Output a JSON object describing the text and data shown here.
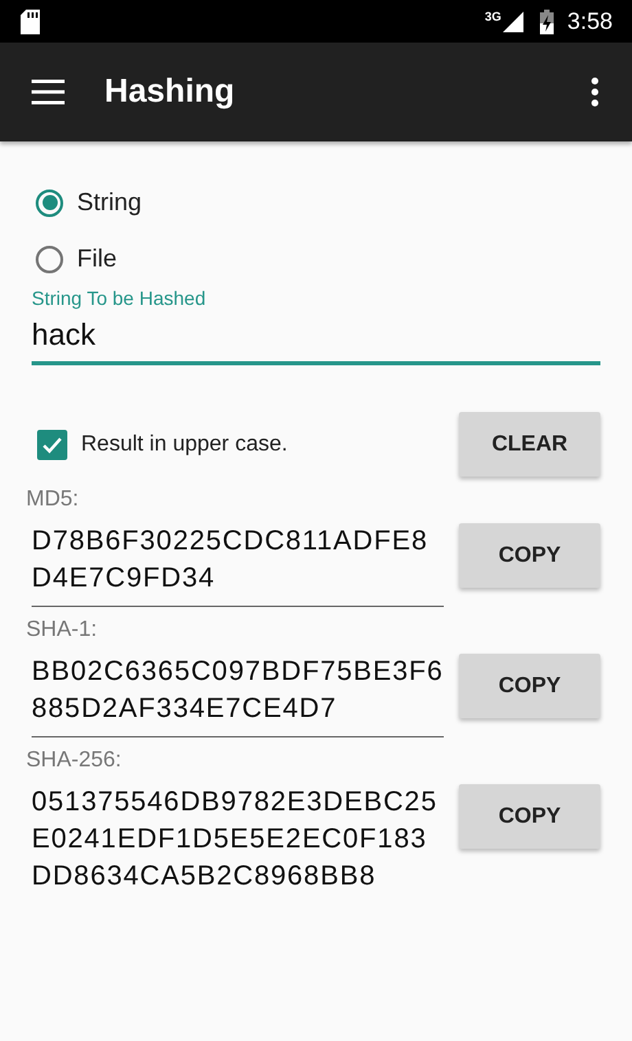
{
  "status_bar": {
    "network": "3G",
    "time": "3:58"
  },
  "app_bar": {
    "title": "Hashing"
  },
  "input_modes": [
    {
      "label": "String",
      "selected": true
    },
    {
      "label": "File",
      "selected": false
    }
  ],
  "input": {
    "label": "String To be Hashed",
    "value": "hack",
    "focused": true
  },
  "uppercase": {
    "label": "Result in upper case.",
    "checked": true
  },
  "clear_button": "CLEAR",
  "hashes": [
    {
      "label": "MD5:",
      "value": "D78B6F30225CDC811ADFE8D4E7C9FD34",
      "button": "COPY",
      "underlined": true
    },
    {
      "label": "SHA-1:",
      "value": "BB02C6365C097BDF75BE3F6885D2AF334E7CE4D7",
      "button": "COPY",
      "underlined": true
    },
    {
      "label": "SHA-256:",
      "value": "051375546DB9782E3DEBC25E0241EDF1D5E5E2EC0F183DD8634CA5B2C8968BB8",
      "button": "COPY",
      "underlined": false
    }
  ]
}
